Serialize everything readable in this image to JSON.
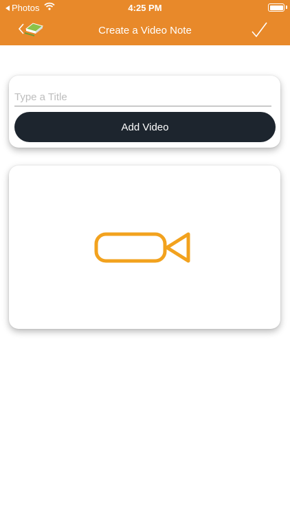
{
  "status_bar": {
    "back_app": "Photos",
    "time": "4:25 PM"
  },
  "nav": {
    "title": "Create a Video Note",
    "back_icon": "book-stack-icon",
    "done_icon": "checkmark-icon"
  },
  "title_card": {
    "title_placeholder": "Type a Title",
    "title_value": "",
    "add_video_label": "Add Video"
  },
  "video_card": {
    "icon": "video-camera-icon"
  },
  "colors": {
    "header": "#e8892a",
    "button": "#1d252e",
    "camera_icon": "#f2a21e"
  }
}
